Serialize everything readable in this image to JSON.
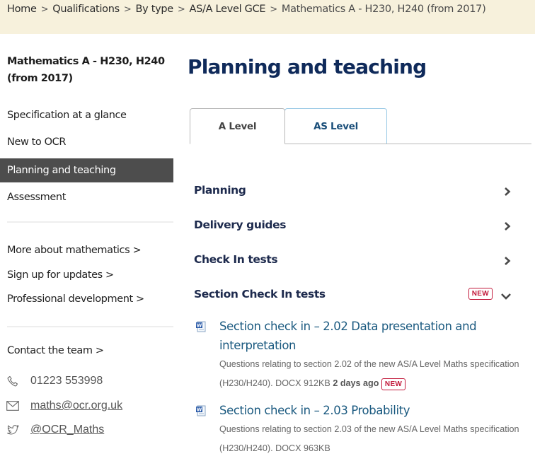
{
  "breadcrumb": {
    "items": [
      "Home",
      "Qualifications",
      "By type",
      "AS/A Level GCE",
      "Mathematics A - H230, H240 (from 2017)"
    ],
    "separator": ">"
  },
  "sidebar": {
    "title": "Mathematics A - H230, H240 (from 2017)",
    "nav": [
      {
        "label": "Specification at a glance",
        "active": false
      },
      {
        "label": "New to OCR",
        "active": false
      },
      {
        "label": "Planning and teaching",
        "active": true
      },
      {
        "label": "Assessment",
        "active": false
      }
    ],
    "links": [
      "More about mathematics >",
      "Sign up for updates >",
      "Professional development >"
    ],
    "contact": {
      "heading": "Contact the team >",
      "phone": {
        "icon": "phone-icon",
        "value": "01223 553998"
      },
      "email": {
        "icon": "email-icon",
        "value": "maths@ocr.org.uk"
      },
      "twitter": {
        "icon": "twitter-icon",
        "value": "@OCR_Maths"
      }
    }
  },
  "main": {
    "title": "Planning and teaching",
    "tabs": [
      {
        "label": "A Level",
        "selected": true
      },
      {
        "label": "AS Level",
        "selected": false
      }
    ],
    "accordion": [
      {
        "label": "Planning",
        "state": "collapsed",
        "icon": "chevron-right-icon"
      },
      {
        "label": "Delivery guides",
        "state": "collapsed",
        "icon": "chevron-right-icon"
      },
      {
        "label": "Check In tests",
        "state": "collapsed",
        "icon": "chevron-right-icon"
      },
      {
        "label": "Section Check In tests",
        "state": "expanded",
        "icon": "chevron-down-icon",
        "badge": "NEW"
      }
    ],
    "documents": [
      {
        "icon": "word-document-icon",
        "title": "Section check in – 2.02 Data presentation and interpretation",
        "description": "Questions relating to section 2.02 of the new AS/A Level Maths specification (H230/H240).",
        "filetype": "DOCX",
        "size": "912KB",
        "updated": "2 days ago",
        "badge": "NEW"
      },
      {
        "icon": "word-document-icon",
        "title": "Section check in – 2.03 Probability",
        "description": "Questions relating to section 2.03 of the new AS/A Level Maths specification (H230/H240).",
        "filetype": "DOCX",
        "size": "963KB"
      }
    ]
  },
  "colors": {
    "breadcrumb_bg": "#f7f1dc",
    "heading_navy": "#0f2a5a",
    "active_nav_bg": "#4d4d4d",
    "link_blue": "#1b5a80",
    "new_badge_red": "#c2193b",
    "tab_border_blue": "#9ccbe6"
  }
}
